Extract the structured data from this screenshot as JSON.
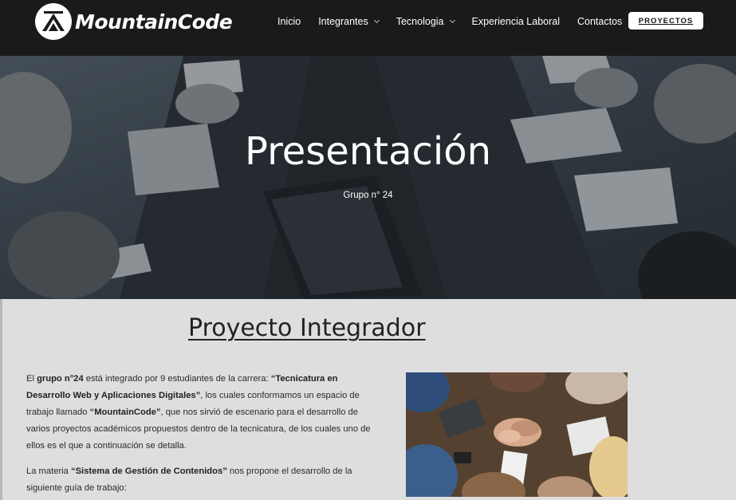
{
  "brand": {
    "name": "MountainCode",
    "logo_icon": "mountain-logo-icon"
  },
  "nav": {
    "items": [
      {
        "label": "Inicio",
        "dropdown": false
      },
      {
        "label": "Integrantes",
        "dropdown": true
      },
      {
        "label": "Tecnologia",
        "dropdown": true
      },
      {
        "label": "Experiencia Laboral",
        "dropdown": false
      },
      {
        "label": "Contactos",
        "dropdown": false
      }
    ],
    "cta_label": "PROYECTOS"
  },
  "hero": {
    "title": "Presentación",
    "subtitle": "Grupo n° 24"
  },
  "main": {
    "section_title": "Proyecto Integrador",
    "paragraph1": {
      "t1": "El ",
      "b1": "grupo n°24",
      "t2": " está integrado por 9 estudiantes de la carrera: ",
      "b2": "“Tecnicatura en Desarrollo Web y Aplicaciones Digitales”",
      "t3": ", los cuales conformamos un espacio de trabajo llamado ",
      "b3": "“MountainCode”",
      "t4": ", que nos sirvió de escenario para el desarrollo de varios proyectos académicos propuestos dentro de la tecnicatura, de los cuales uno de ellos es el que a continuación se detalla."
    },
    "paragraph2": {
      "t1": "La materia ",
      "b1": "“Sistema de Gestión de Contenidos”",
      "t2": " nos propone el desarrollo de la siguiente guía de trabajo:"
    }
  },
  "colors": {
    "header_bg": "#1a1a1a",
    "main_bg": "#dedede",
    "text": "#2a2a2a",
    "cta_bg": "#ffffff"
  }
}
